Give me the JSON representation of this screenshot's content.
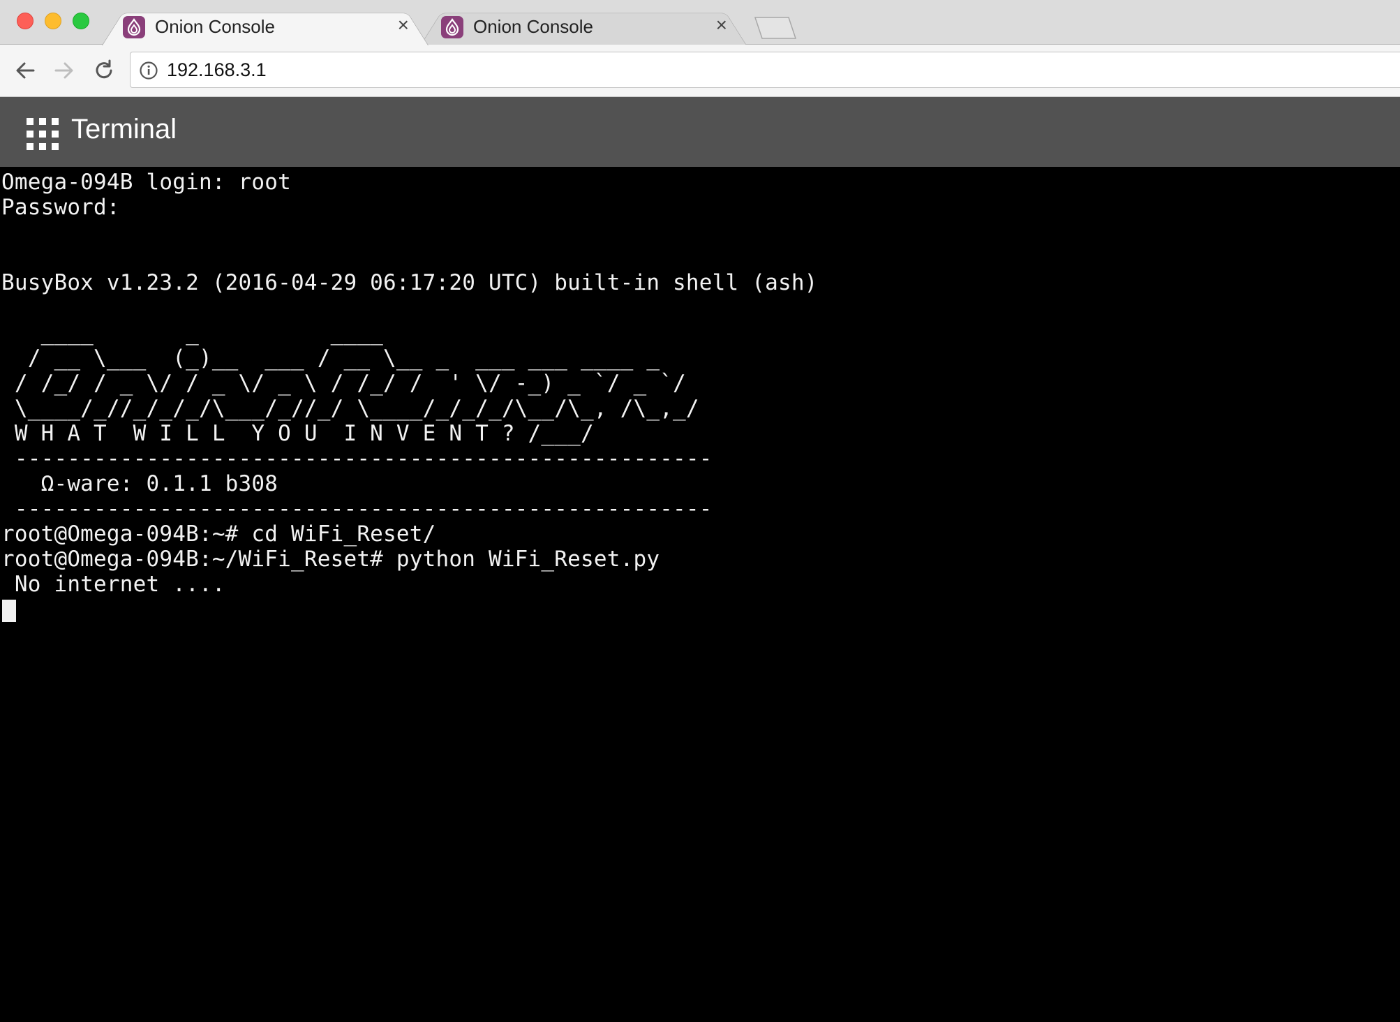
{
  "window": {
    "tabs": [
      {
        "title": "Onion Console",
        "active": true,
        "icon": "onion-favicon-icon"
      },
      {
        "title": "Onion Console",
        "active": false,
        "icon": "onion-favicon-icon"
      }
    ],
    "close_glyph": "×"
  },
  "address_bar": {
    "url": "192.168.3.1"
  },
  "app": {
    "title": "Terminal",
    "menu_icon": "apps-grid-icon",
    "header_color": "#525252"
  },
  "terminal": {
    "background": "#000000",
    "foreground": "#f2f2f2",
    "lines": [
      "Omega-094B login: root",
      "Password: ",
      "",
      "",
      "BusyBox v1.23.2 (2016-04-29 06:17:20 UTC) built-in shell (ash)",
      "",
      "   ____       _          ____",
      "  / __ \\___  (_)__  ___ / __ \\__ _  ___ ___ ____ _",
      " / /_/ / _ \\/ / _ \\/ _ \\ / /_/ /  ' \\/ -_) _ `/ _ `/",
      " \\____/_//_/_/_/\\___/_//_/ \\____/_/_/_/\\__/\\_, /\\_,_/",
      " W H A T  W I L L  Y O U  I N V E N T ? /___/",
      " -----------------------------------------------------",
      "   Ω-ware: 0.1.1 b308",
      " -----------------------------------------------------",
      "root@Omega-094B:~# cd WiFi_Reset/",
      "root@Omega-094B:~/WiFi_Reset# python WiFi_Reset.py",
      " No internet ...."
    ]
  }
}
